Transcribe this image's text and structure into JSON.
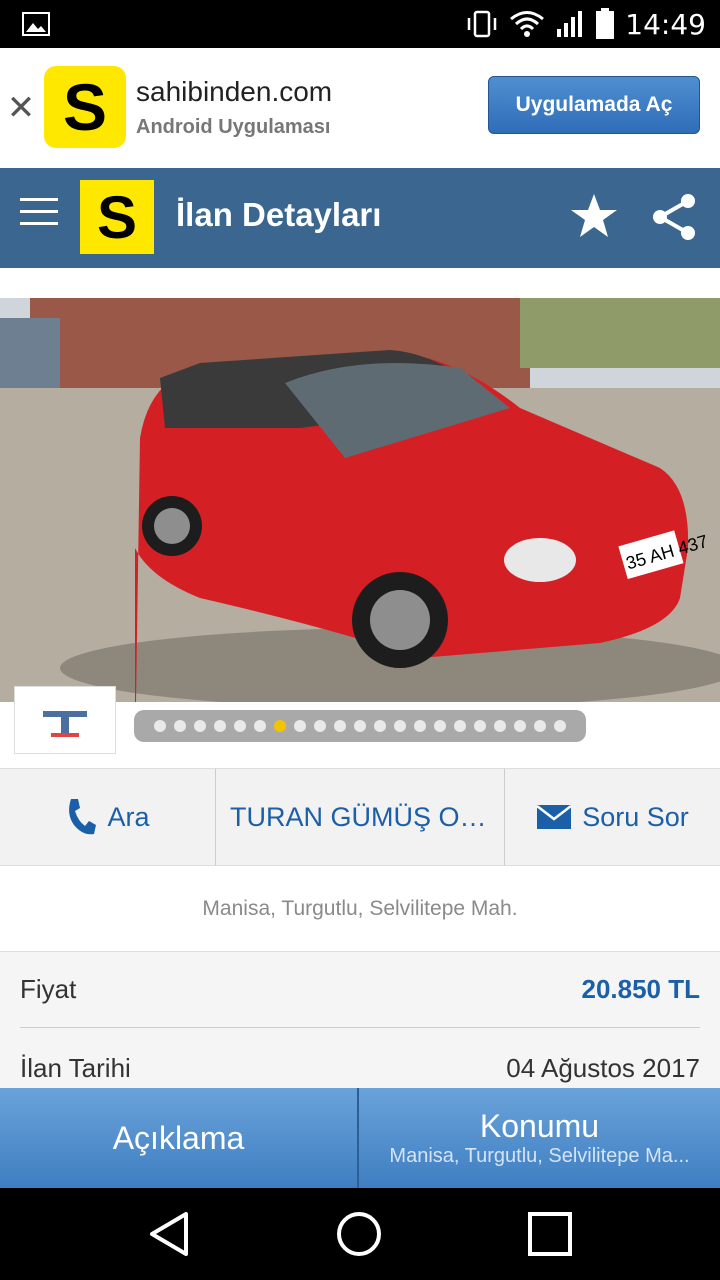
{
  "status_bar": {
    "time": "14:49"
  },
  "banner": {
    "logo_letter": "S",
    "title": "sahibinden.com",
    "subtitle": "Android Uygulaması",
    "open_label": "Uygulamada Aç",
    "close_glyph": "✕"
  },
  "header": {
    "logo_letter": "S",
    "title": "İlan Detayları"
  },
  "gallery": {
    "plate_text": "35 AH 437",
    "total_images": 21,
    "active_index": 6
  },
  "actions": {
    "call_label": "Ara",
    "seller_label": "TURAN GÜMÜŞ OT...",
    "message_label": "Soru Sor"
  },
  "location": "Manisa, Turgutlu, Selvilitepe Mah.",
  "details": {
    "price_label": "Fiyat",
    "price_value": "20.850 TL",
    "date_label": "İlan Tarihi",
    "date_value": "04 Ağustos 2017"
  },
  "tabs": {
    "description_label": "Açıklama",
    "location_label": "Konumu",
    "location_sub": "Manisa, Turgutlu, Selvilitepe Ma..."
  },
  "colors": {
    "header_bg": "#3a6690",
    "logo_yellow": "#ffe800",
    "link_blue": "#1a5fa8",
    "tab_blue": "#4f8fd0",
    "car_red": "#d41f25"
  }
}
